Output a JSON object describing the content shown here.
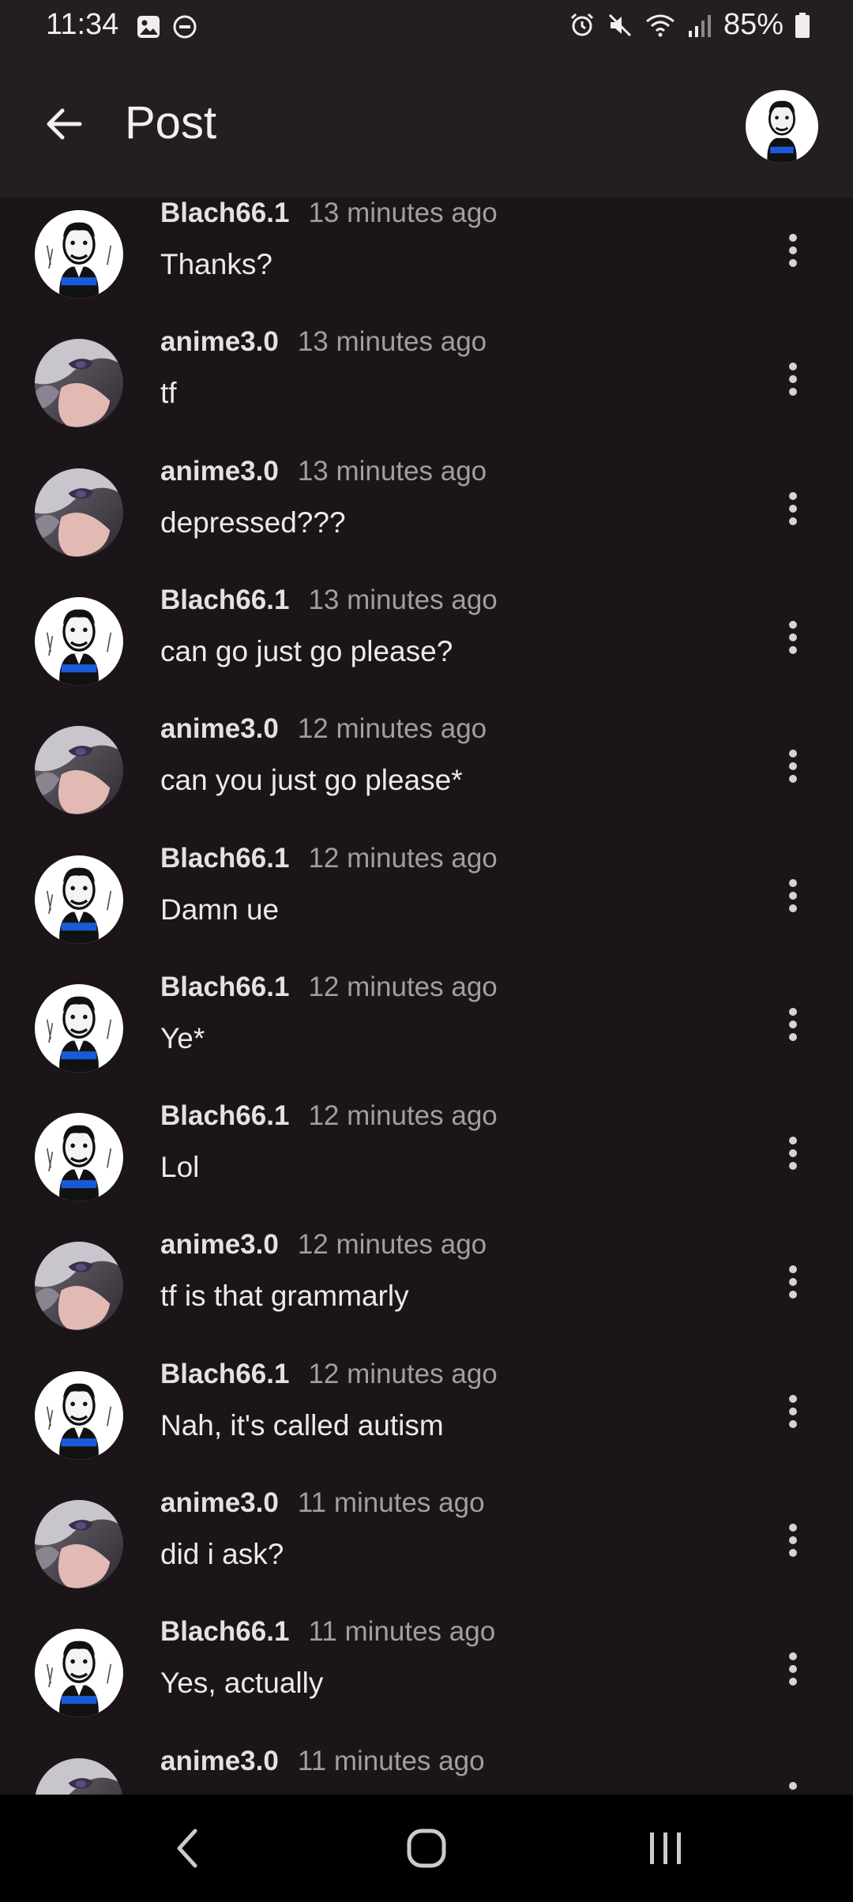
{
  "status_bar": {
    "time": "11:34",
    "battery": "85%",
    "left_icons": [
      "image-icon",
      "do-not-disturb-icon"
    ],
    "right_icons": [
      "alarm-icon",
      "mute-icon",
      "wifi-icon",
      "signal-icon",
      "battery-icon"
    ]
  },
  "header": {
    "title": "Post"
  },
  "comments": [
    {
      "author": "Blach66.1",
      "time": "13 minutes ago",
      "text": "Thanks?",
      "avatar": "man-portrait"
    },
    {
      "author": "anime3.0",
      "time": "13 minutes ago",
      "text": "tf",
      "avatar": "anime-girl"
    },
    {
      "author": "anime3.0",
      "time": "13 minutes ago",
      "text": "depressed???",
      "avatar": "anime-girl"
    },
    {
      "author": "Blach66.1",
      "time": "13 minutes ago",
      "text": "can go just go please?",
      "avatar": "man-portrait"
    },
    {
      "author": "anime3.0",
      "time": "12 minutes ago",
      "text": "can you just go please*",
      "avatar": "anime-girl"
    },
    {
      "author": "Blach66.1",
      "time": "12 minutes ago",
      "text": "Damn ue",
      "avatar": "man-portrait"
    },
    {
      "author": "Blach66.1",
      "time": "12 minutes ago",
      "text": "Ye*",
      "avatar": "man-portrait"
    },
    {
      "author": "Blach66.1",
      "time": "12 minutes ago",
      "text": "Lol",
      "avatar": "man-portrait"
    },
    {
      "author": "anime3.0",
      "time": "12 minutes ago",
      "text": "tf is that grammarly",
      "avatar": "anime-girl"
    },
    {
      "author": "Blach66.1",
      "time": "12 minutes ago",
      "text": "Nah, it's called autism",
      "avatar": "man-portrait"
    },
    {
      "author": "anime3.0",
      "time": "11 minutes ago",
      "text": "did i ask?",
      "avatar": "anime-girl"
    },
    {
      "author": "Blach66.1",
      "time": "11 minutes ago",
      "text": "Yes, actually",
      "avatar": "man-portrait"
    },
    {
      "author": "anime3.0",
      "time": "11 minutes ago",
      "text": "",
      "avatar": "anime-girl"
    }
  ],
  "nav_bar": {
    "buttons": [
      "back",
      "home",
      "recents"
    ]
  }
}
